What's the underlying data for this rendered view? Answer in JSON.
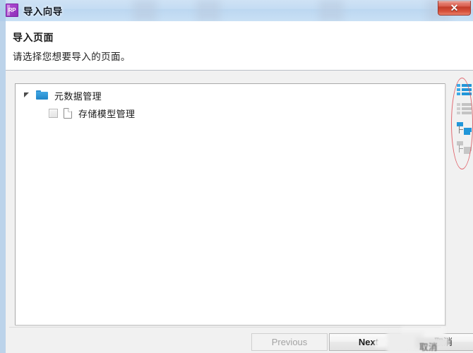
{
  "window": {
    "title": "导入向导",
    "app_icon_label": "RP",
    "close_label": "✕",
    "accent_blue": "#2196d9",
    "titlebar_color": "#c4dcf3",
    "close_color": "#c03b29"
  },
  "header": {
    "title": "导入页面",
    "subtitle": "请选择您想要导入的页面。"
  },
  "tree": {
    "nodes": [
      {
        "label": "元数据管理",
        "type": "folder",
        "expanded": true,
        "has_checkbox": false
      },
      {
        "label": "存储模型管理",
        "type": "page",
        "checked": false,
        "has_checkbox": true
      }
    ]
  },
  "rail": {
    "buttons": [
      {
        "name": "select-all-icon",
        "state": "active"
      },
      {
        "name": "deselect-all-icon",
        "state": "inactive"
      },
      {
        "name": "expand-all-icon",
        "state": "active"
      },
      {
        "name": "collapse-all-icon",
        "state": "inactive"
      }
    ]
  },
  "annotation": {
    "shape": "ellipse",
    "color": "#e05a63"
  },
  "footer": {
    "previous_label": "Previous",
    "previous_enabled": false,
    "next_label": "Next",
    "next_enabled": true,
    "cancel_label": "取消"
  }
}
